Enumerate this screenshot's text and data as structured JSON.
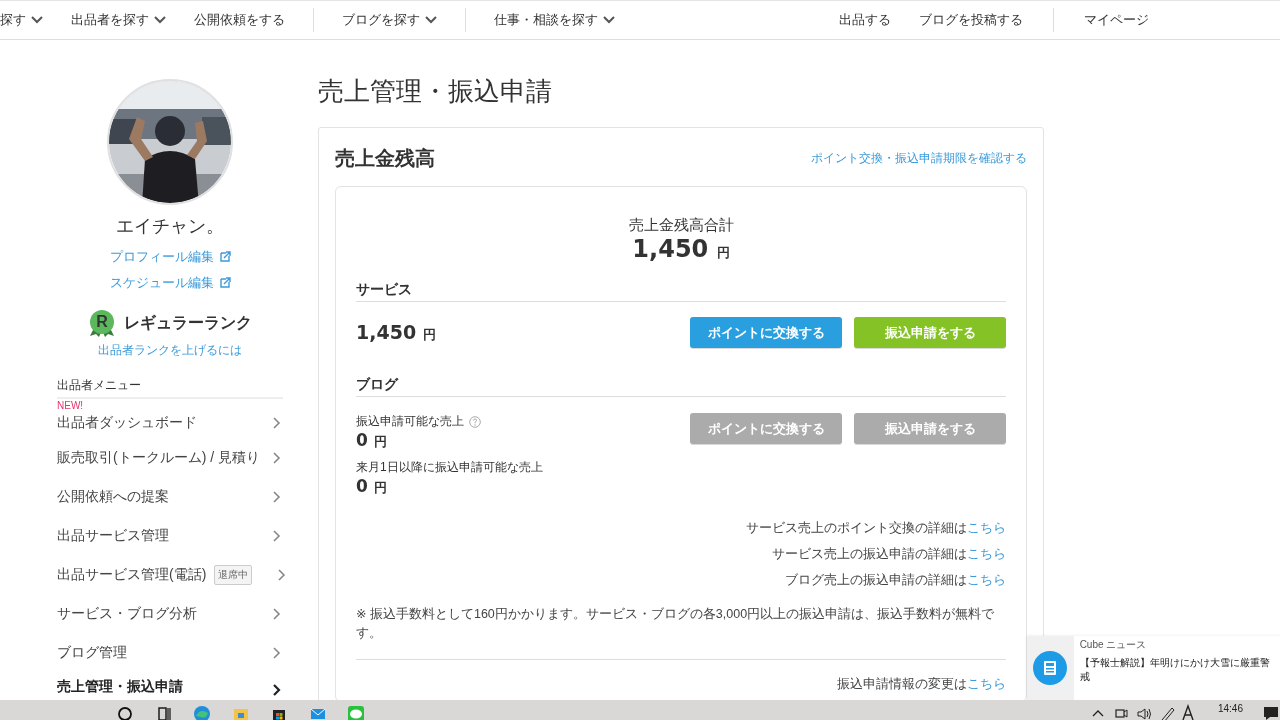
{
  "top_nav": {
    "left_groups": [
      [
        {
          "label": "探す",
          "dropdown": true
        },
        {
          "label": "出品者を探す",
          "dropdown": true
        },
        {
          "label": "公開依頼をする",
          "dropdown": false
        }
      ],
      [
        {
          "label": "ブログを探す",
          "dropdown": true
        }
      ],
      [
        {
          "label": "仕事・相談を探す",
          "dropdown": true
        }
      ]
    ],
    "right_groups": [
      [
        "出品する",
        "ブログを投稿する"
      ],
      [
        "マイページ"
      ]
    ]
  },
  "sidebar": {
    "user_name": "エイチャン。",
    "profile_links": [
      "プロフィール編集",
      "スケジュール編集"
    ],
    "rank": {
      "badge_letter": "R",
      "name": "レギュラーランク",
      "link": "出品者ランクを上げるには"
    },
    "menu_title": "出品者メニュー",
    "menu": [
      {
        "label": "出品者ダッシュボード",
        "badge": "NEW!",
        "selected": false
      },
      {
        "label": "販売取引(トークルーム) / 見積り",
        "selected": false
      },
      {
        "label": "公開依頼への提案",
        "selected": false
      },
      {
        "label": "出品サービス管理",
        "selected": false
      },
      {
        "label": "出品サービス管理(電話)",
        "tag": "退席中",
        "selected": false
      },
      {
        "label": "サービス・ブログ分析",
        "selected": false
      },
      {
        "label": "ブログ管理",
        "selected": false
      },
      {
        "label": "売上管理・振込申請",
        "selected": true
      }
    ]
  },
  "main": {
    "title": "売上管理・振込申請",
    "balance": {
      "heading": "売上金残高",
      "deadline_link": "ポイント交換・振込申請期限を確認する",
      "total_label": "売上金残高合計",
      "total_amount": "1,450",
      "total_unit": "円",
      "sections": [
        {
          "kind": "service",
          "heading": "サービス",
          "amount": "1,450",
          "unit": "円",
          "buttons": [
            {
              "label": "ポイントに交換する",
              "kind": "points",
              "disabled": false
            },
            {
              "label": "振込申請をする",
              "kind": "transfer",
              "disabled": false
            }
          ]
        },
        {
          "kind": "blog",
          "heading": "ブログ",
          "lines": [
            {
              "label": "振込申請可能な売上",
              "help": true,
              "amount": "0",
              "unit": "円"
            },
            {
              "label": "来月1日以降に振込申請可能な売上",
              "help": false,
              "amount": "0",
              "unit": "円"
            }
          ],
          "buttons": [
            {
              "label": "ポイントに交換する",
              "kind": "points",
              "disabled": true
            },
            {
              "label": "振込申請をする",
              "kind": "transfer",
              "disabled": true
            }
          ]
        }
      ],
      "detail_links": [
        {
          "text": "サービス売上のポイント交換の詳細は",
          "link": "こちら"
        },
        {
          "text": "サービス売上の振込申請の詳細は",
          "link": "こちら"
        },
        {
          "text": "ブログ売上の振込申請の詳細は",
          "link": "こちら"
        }
      ],
      "note": "※ 振込手数料として160円かかります。サービス・ブログの各3,000円以上の振込申請は、振込手数料が無料です。",
      "change_link": {
        "text": "振込申請情報の変更は",
        "link": "こちら"
      }
    }
  },
  "notification": {
    "app": "Cube ニュース",
    "text": "【予報士解説】年明けにかけ大雪に厳重警戒"
  },
  "taskbar": {
    "time": "14:46"
  }
}
